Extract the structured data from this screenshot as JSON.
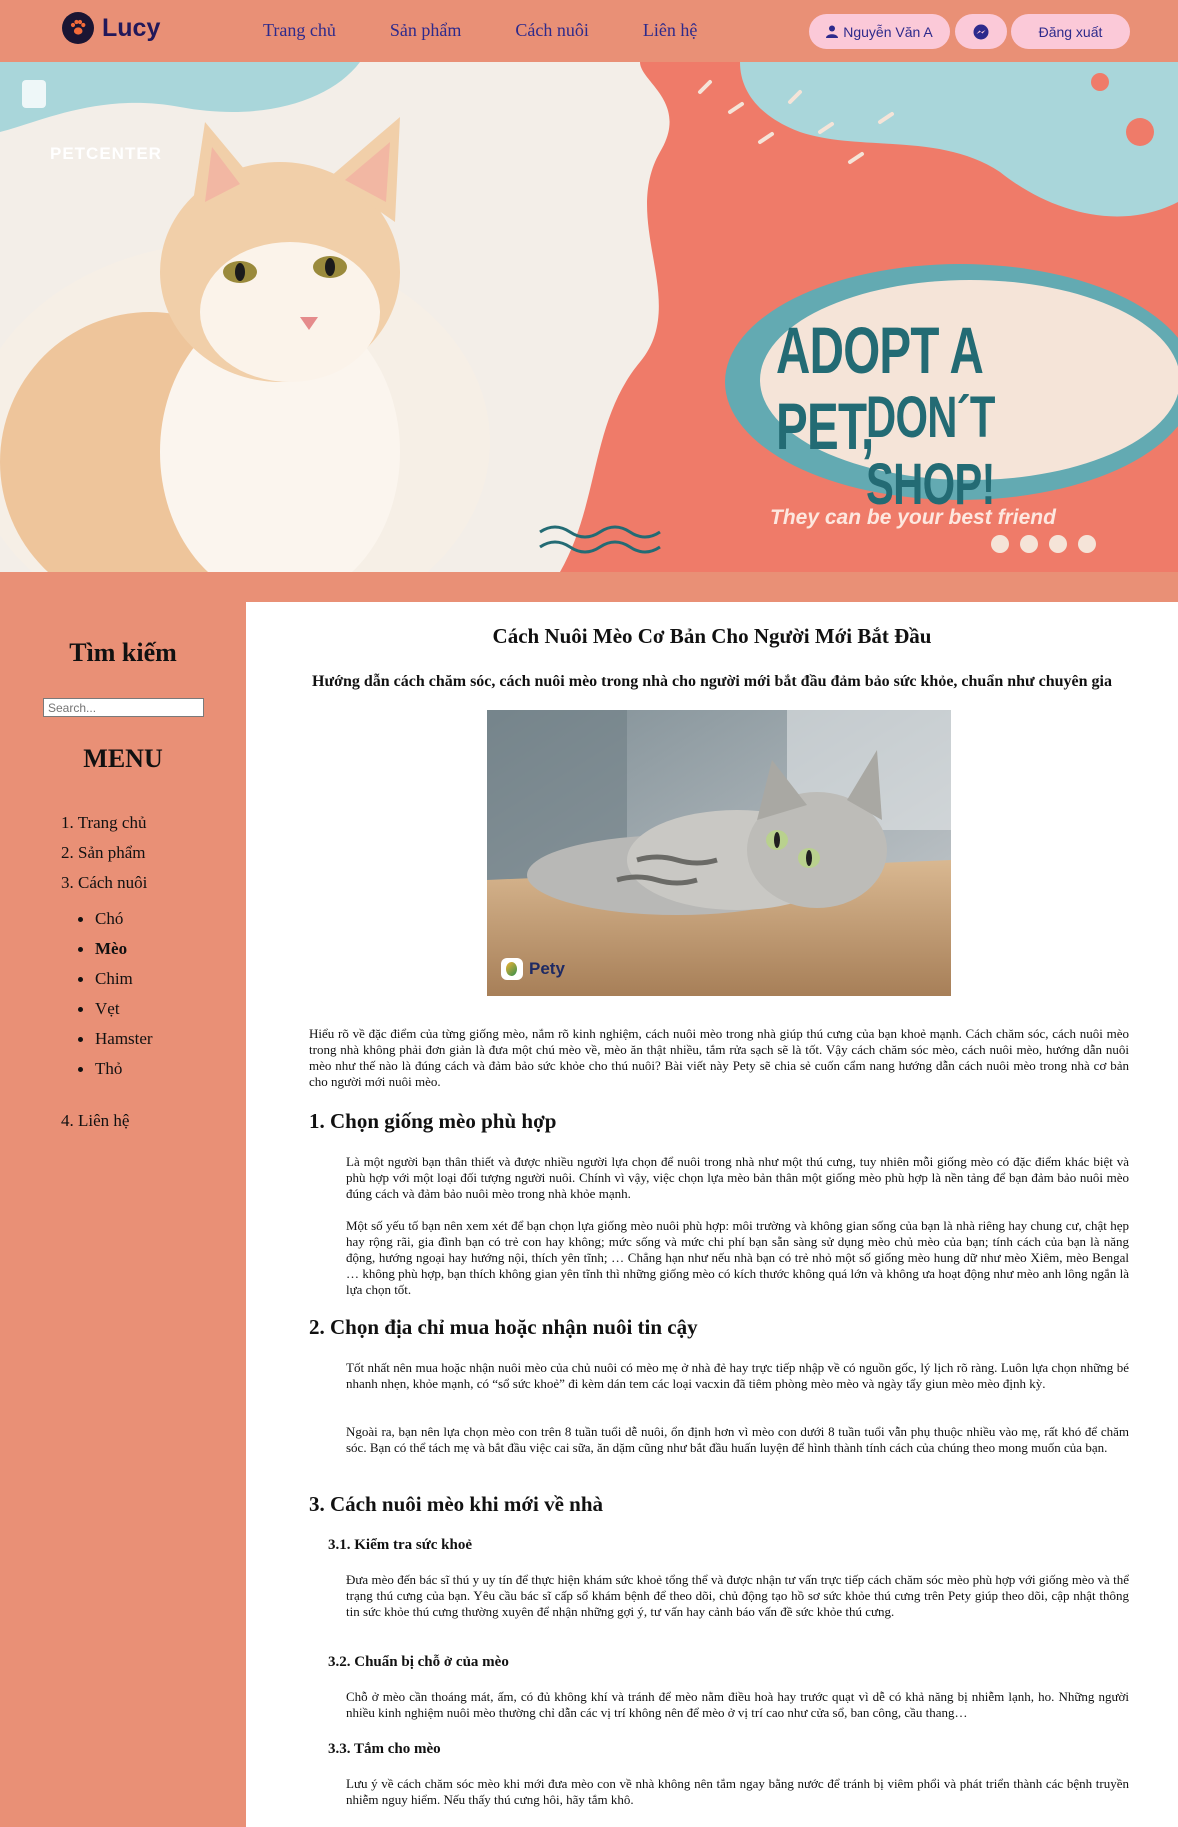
{
  "header": {
    "logo_text": "Lucy",
    "nav": [
      "Trang chủ",
      "Sản phẩm",
      "Cách nuôi",
      "Liên hệ"
    ],
    "user_name": "Nguyễn Văn A",
    "logout_label": "Đăng xuất",
    "accent_color": "#e99076",
    "pill_color": "#fbc9d8"
  },
  "hero": {
    "brand_text": "PETCENTER",
    "title_line1": "ADOPT A PET,",
    "title_line2": "DON´T SHOP!",
    "tagline": "They can be your best friend"
  },
  "sidebar": {
    "search_title": "Tìm kiếm",
    "search_placeholder": "Search...",
    "menu_title": "MENU",
    "items": [
      "1. Trang chủ",
      "2. Sản phẩm",
      "3. Cách nuôi"
    ],
    "subitems": [
      "Chó",
      "Mèo",
      "Chim",
      "Vẹt",
      "Hamster",
      "Thỏ"
    ],
    "active_subitem": "Mèo",
    "last_item": "4. Liên hệ"
  },
  "article": {
    "title": "Cách Nuôi Mèo Cơ Bản Cho Người Mới Bắt Đầu",
    "subtitle": "Hướng dẫn cách chăm sóc, cách nuôi mèo trong nhà cho người mới bắt đầu đảm bảo sức khỏe, chuẩn như chuyên gia",
    "image_caption": "Pety",
    "intro": "Hiểu rõ về đặc điểm của từng giống mèo, nắm rõ kinh nghiệm, cách nuôi mèo trong nhà giúp thú cưng của bạn khoẻ mạnh. Cách chăm sóc, cách nuôi mèo trong nhà không phải đơn giản là đưa một chú mèo về, mèo ăn thật nhiều, tắm rửa sạch sẽ là tốt. Vậy cách chăm sóc mèo, cách nuôi mèo, hướng dẫn nuôi mèo như thế nào là đúng cách và đảm bảo sức khỏe cho thú nuôi? Bài viết này Pety sẽ chia sẻ cuốn cẩm nang hướng dẫn cách nuôi mèo trong nhà cơ bản cho người mới nuôi mèo.",
    "s1_title": "1. Chọn giống mèo phù hợp",
    "s1_p1": "Là một người bạn thân thiết và được nhiều người lựa chọn để nuôi trong nhà như một thú cưng, tuy nhiên mỗi giống mèo có đặc điểm khác biệt và phù hợp với một loại đối tượng người nuôi. Chính vì vậy, việc chọn lựa mèo bản thân một giống mèo phù hợp là nền tảng để bạn đảm bảo nuôi mèo đúng cách và đảm bảo nuôi mèo trong nhà khỏe mạnh.",
    "s1_p2": "Một số yếu tố bạn nên xem xét để bạn chọn lựa giống mèo nuôi phù hợp: môi trường và không gian sống của bạn là nhà riêng hay chung cư, chật hẹp hay rộng rãi, gia đình bạn có trẻ con hay không; mức sống và mức chi phí bạn sẵn sàng sử dụng mèo chủ mèo của bạn; tính cách của bạn là năng động, hướng ngoại hay hướng nội, thích yên tĩnh; … Chẳng hạn như nếu nhà bạn có trẻ nhỏ một số giống mèo hung dữ như mèo Xiêm, mèo Bengal … không phù hợp, bạn thích không gian yên tĩnh thì những giống mèo có kích thước không quá lớn và không ưa hoạt động như mèo anh lông ngắn là lựa chọn tốt.",
    "s2_title": "2. Chọn địa chỉ mua hoặc nhận nuôi tin cậy",
    "s2_p1": "Tốt nhất nên mua hoặc nhận nuôi mèo của chủ nuôi có mèo mẹ ở nhà đẻ hay trực tiếp nhập về có nguồn gốc, lý lịch rõ ràng. Luôn lựa chọn những bé nhanh nhẹn, khỏe mạnh, có “sổ sức khoẻ” đi kèm dán tem các loại vacxin đã tiêm phòng mèo mèo và ngày tẩy giun mèo mèo định kỳ.",
    "s2_p2": "Ngoài ra, bạn nên lựa chọn mèo con trên 8 tuần tuổi dễ nuôi, ổn định hơn vì mèo con dưới 8 tuần tuổi vẫn phụ thuộc nhiều vào mẹ, rất khó để chăm sóc. Bạn có thể tách mẹ và bắt đầu việc cai sữa, ăn dặm cũng như bắt đầu huấn luyện để hình thành tính cách của chúng theo mong muốn của bạn.",
    "s3_title": "3. Cách nuôi mèo khi mới về nhà",
    "s31_title": "3.1. Kiểm tra sức khoẻ",
    "s31_p": "Đưa mèo đến bác sĩ thú y uy tín để thực hiện khám sức khoẻ tổng thể và được nhận tư vấn trực tiếp cách chăm sóc mèo phù hợp với giống mèo và thể trạng thú cưng của bạn. Yêu cầu bác sĩ cấp sổ khám bệnh để theo dõi, chủ động tạo hồ sơ sức khỏe thú cưng trên Pety giúp theo dõi, cập nhật thông tin sức khỏe thú cưng thường xuyên để nhận những gợi ý, tư vấn hay cảnh báo vấn đề sức khỏe thú cưng.",
    "s32_title": "3.2. Chuẩn bị chỗ ở của mèo",
    "s32_p": "Chỗ ở mèo cần thoáng mát, ấm, có đủ không khí và tránh để mèo nằm điều hoà hay trước quạt vì dễ có khả năng bị nhiễm lạnh, ho. Những người nhiều kinh nghiệm nuôi mèo thường chỉ dẫn các vị trí không nên để mèo ở vị trí cao như cửa sổ, ban công, cầu thang…",
    "s33_title": "3.3. Tắm cho mèo",
    "s33_p": "Lưu ý về cách chăm sóc mèo khi mới đưa mèo con về nhà không nên tắm ngay bằng nước để tránh bị viêm phổi và phát triển thành các bệnh truyền nhiễm nguy hiểm. Nếu thấy thú cưng hôi, hãy tắm khô."
  }
}
